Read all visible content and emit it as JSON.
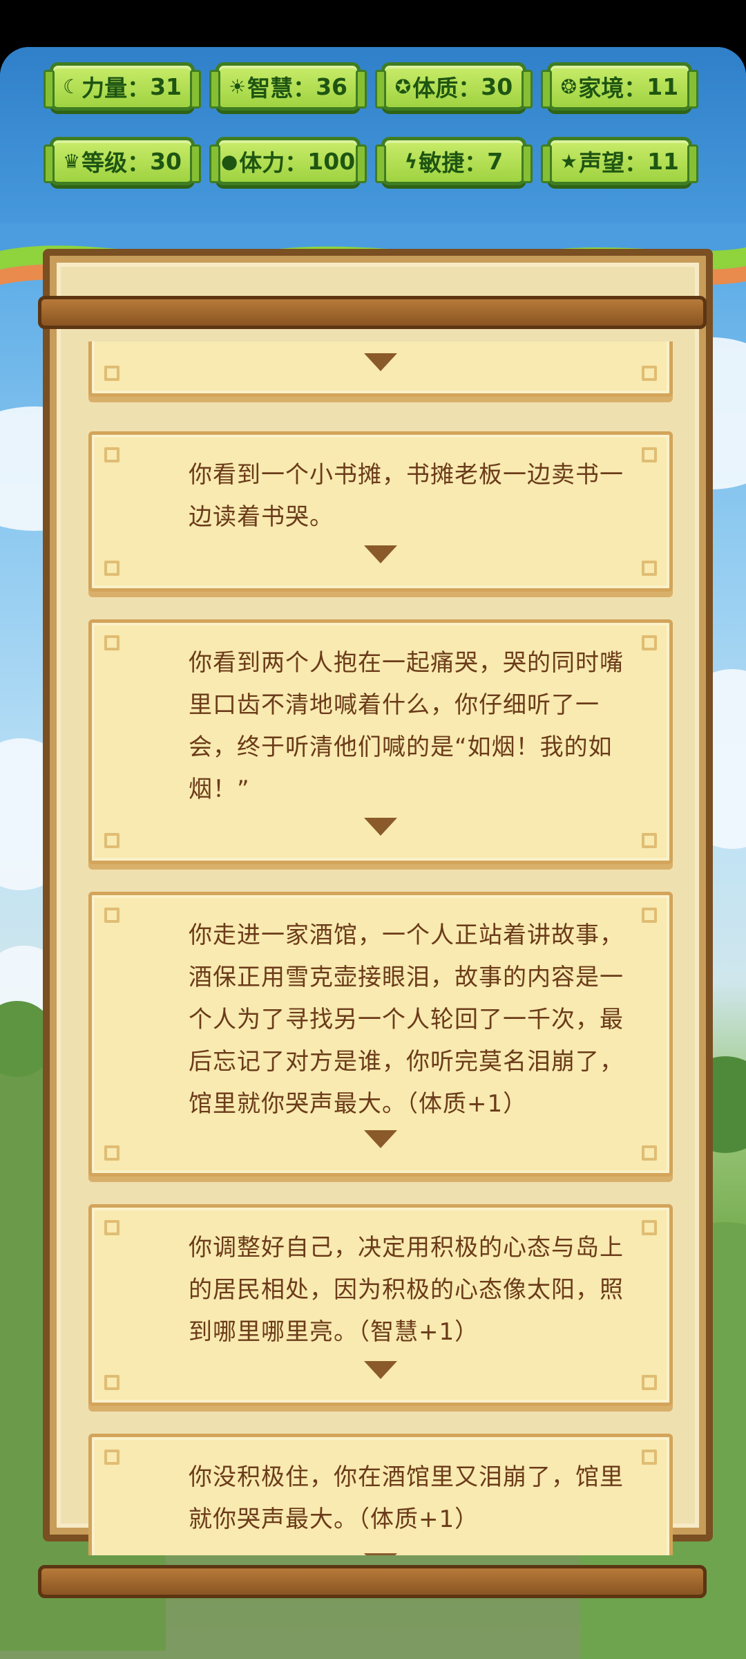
{
  "stats": [
    {
      "icon": "strength-icon",
      "glyph": "☾",
      "label": "力量：",
      "value": "31"
    },
    {
      "icon": "wisdom-icon",
      "glyph": "☀",
      "label": "智慧：",
      "value": "36"
    },
    {
      "icon": "constitution-icon",
      "glyph": "✪",
      "label": "体质：",
      "value": "30"
    },
    {
      "icon": "family-icon",
      "glyph": "❂",
      "label": "家境：",
      "value": "11"
    },
    {
      "icon": "crown-icon",
      "glyph": "♛",
      "label": "等级：",
      "value": "30"
    },
    {
      "icon": "heart-icon",
      "glyph": "●",
      "label": "体力：",
      "value": "100"
    },
    {
      "icon": "lightning-icon",
      "glyph": "ϟ",
      "label": "敏捷：",
      "value": "7"
    },
    {
      "icon": "star-icon",
      "glyph": "★",
      "label": "声望：",
      "value": "11"
    }
  ],
  "events": [
    {
      "text": ""
    },
    {
      "text": "你看到一个小书摊，书摊老板一边卖书一边读着书哭。"
    },
    {
      "text": "你看到两个人抱在一起痛哭，哭的同时嘴里口齿不清地喊着什么，你仔细听了一会，终于听清他们喊的是“如烟！我的如烟！”"
    },
    {
      "text": "你走进一家酒馆，一个人正站着讲故事，酒保正用雪克壶接眼泪，故事的内容是一个人为了寻找另一个人轮回了一千次，最后忘记了对方是谁，你听完莫名泪崩了，馆里就你哭声最大。（体质+1）"
    },
    {
      "text": "你调整好自己，决定用积极的心态与岛上的居民相处，因为积极的心态像太阳，照到哪里哪里亮。（智慧+1）"
    },
    {
      "text": "你没积极住，你在酒馆里又泪崩了，馆里就你哭声最大。（体质+1）"
    }
  ],
  "colors": {
    "badge": "#a8d94a",
    "card": "#f8eab0",
    "text": "#6b3b1a",
    "frame": "#7a4f22"
  }
}
